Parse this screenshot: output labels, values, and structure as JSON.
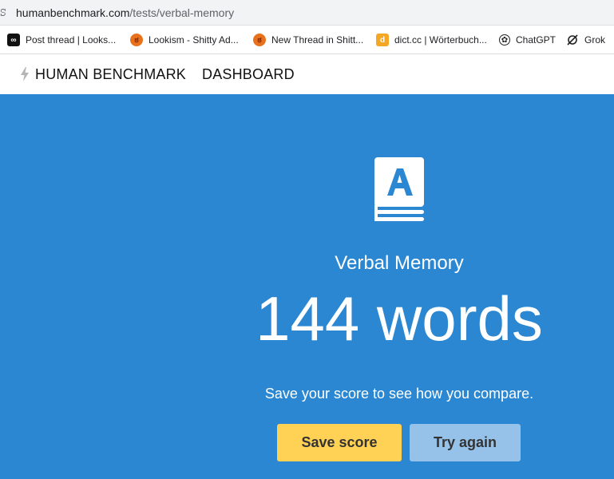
{
  "browser": {
    "url_host": "humanbenchmark.com",
    "url_path": "/tests/verbal-memory",
    "site_icon": "site-info-icon",
    "bookmarks": [
      {
        "label": "Post thread | Looks...",
        "icon": "meta-infinity-icon"
      },
      {
        "label": "Lookism - Shitty Ad...",
        "icon": "angry-face-icon"
      },
      {
        "label": "New Thread in Shitt...",
        "icon": "angry-face-icon"
      },
      {
        "label": "dict.cc | Wörterbuch...",
        "icon": "dict-icon"
      },
      {
        "label": "ChatGPT",
        "icon": "chatgpt-icon"
      },
      {
        "label": "Grok",
        "icon": "grok-icon"
      }
    ]
  },
  "header": {
    "brand": "HUMAN BENCHMARK",
    "dashboard": "DASHBOARD"
  },
  "hero": {
    "icon": "book-a-icon",
    "title": "Verbal Memory",
    "score": "144 words",
    "hint": "Save your score to see how you compare.",
    "save_label": "Save score",
    "try_label": "Try again"
  },
  "colors": {
    "hero_bg": "#2b87d1",
    "save_btn": "#ffd154",
    "try_btn": "#96c2e9"
  }
}
